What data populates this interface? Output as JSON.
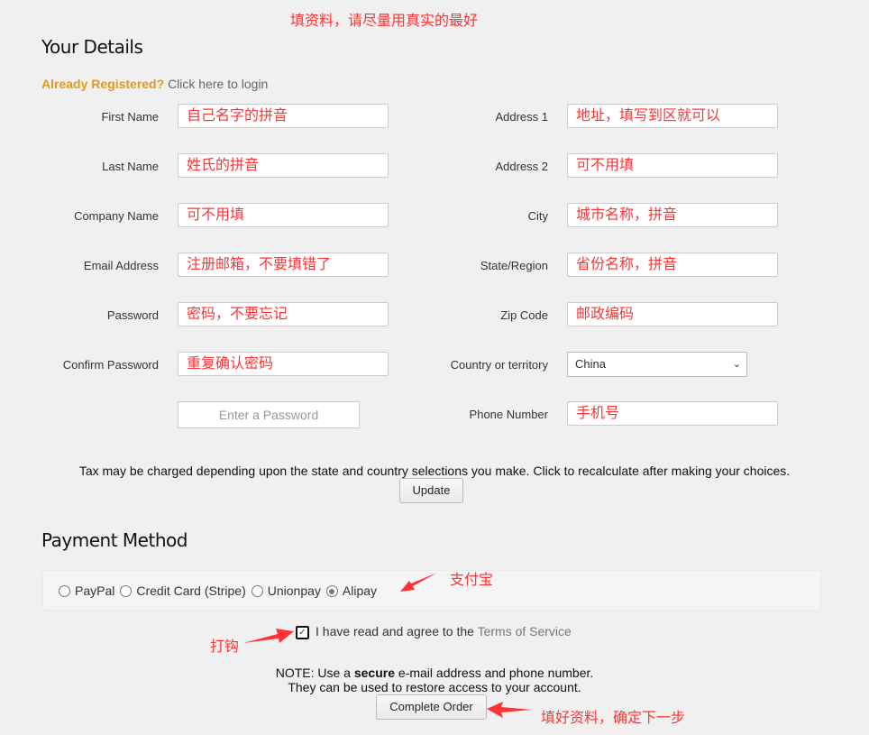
{
  "annotations": {
    "top": "填资料，请尽量用真实的最好",
    "alipay": "支付宝",
    "checkbox": "打钩",
    "complete": "填好资料，确定下一步",
    "accent": "#ff3333"
  },
  "details": {
    "title": "Your Details",
    "already_registered": "Already Registered?",
    "login_link": "Click here to login",
    "left_fields": [
      {
        "label": "First Name",
        "value": "自己名字的拼音"
      },
      {
        "label": "Last Name",
        "value": "姓氏的拼音"
      },
      {
        "label": "Company Name",
        "value": "可不用填"
      },
      {
        "label": "Email Address",
        "value": "注册邮箱，不要填错了"
      },
      {
        "label": "Password",
        "value": "密码，不要忘记"
      },
      {
        "label": "Confirm Password",
        "value": "重复确认密码"
      }
    ],
    "password_strength": "Enter a Password",
    "right_fields": [
      {
        "label": "Address 1",
        "value": "地址，填写到区就可以"
      },
      {
        "label": "Address 2",
        "value": "可不用填"
      },
      {
        "label": "City",
        "value": "城市名称，拼音"
      },
      {
        "label": "State/Region",
        "value": "省份名称，拼音"
      },
      {
        "label": "Zip Code",
        "value": "邮政编码"
      }
    ],
    "country_label": "Country or territory",
    "country_value": "China",
    "phone_label": "Phone Number",
    "phone_value": "手机号",
    "tax_note": "Tax may be charged depending upon the state and country selections you make. Click to recalculate after making your choices.",
    "update_button": "Update"
  },
  "payment": {
    "title": "Payment Method",
    "options": [
      {
        "label": "PayPal",
        "selected": false
      },
      {
        "label": "Credit Card (Stripe)",
        "selected": false
      },
      {
        "label": "Unionpay",
        "selected": false
      },
      {
        "label": "Alipay",
        "selected": true
      }
    ],
    "agree_text": "I have read and agree to the",
    "tos_link": "Terms of Service",
    "agree_checked": true,
    "note_prefix": "NOTE: Use a",
    "note_bold": "secure",
    "note_suffix": "e-mail address and phone number.",
    "note_line2": "They can be used to restore access to your account.",
    "complete_button": "Complete Order"
  }
}
